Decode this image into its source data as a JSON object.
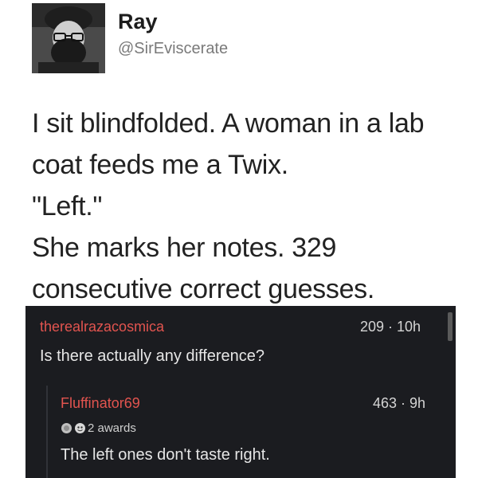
{
  "tweet": {
    "author_name": "Ray",
    "author_handle": "@SirEviscerate",
    "lines": [
      "I sit blindfolded. A woman in a lab",
      "coat feeds me a Twix.",
      "\"Left.\"",
      "She marks her notes. 329",
      "consecutive correct guesses."
    ]
  },
  "comments": [
    {
      "username": "therealrazacosmica",
      "score_time": "209 · 10h",
      "body": "Is there actually any difference?"
    },
    {
      "username": "Fluffinator69",
      "score_time": "463 · 9h",
      "awards": "2 awards",
      "body": "The left ones don't taste right."
    }
  ],
  "icons": {
    "avatar": "bearded-man-with-glasses-photo",
    "award_1": "silver-award-icon",
    "award_2": "helpful-award-icon"
  },
  "colors": {
    "comment_bg": "#1b1c20",
    "username": "#e2544f",
    "comment_text": "#e6e6e6"
  }
}
